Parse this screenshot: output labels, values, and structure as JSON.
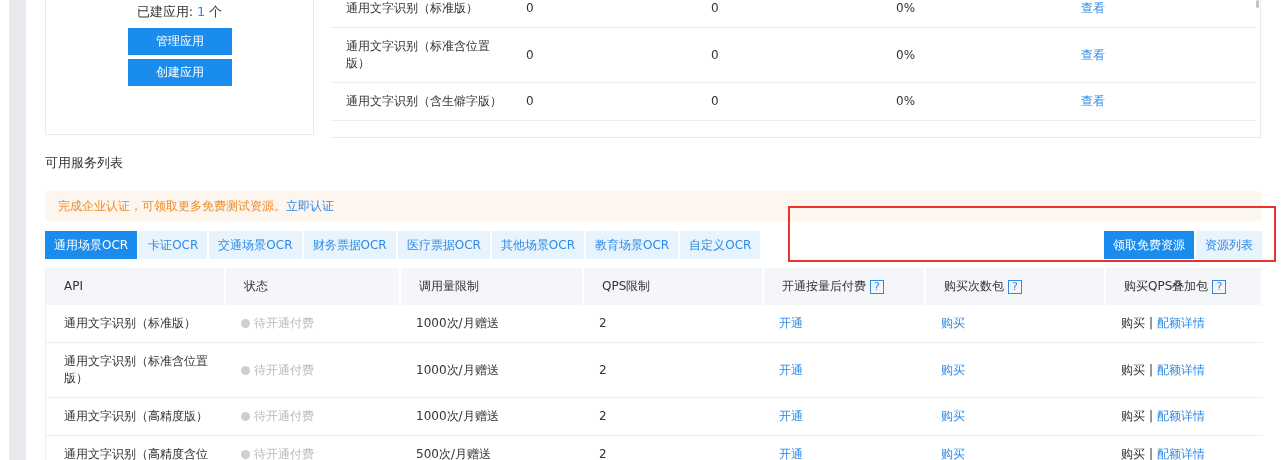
{
  "app_card": {
    "label": "已建应用:",
    "count": "1",
    "unit": "个",
    "buttons": [
      "管理应用",
      "创建应用"
    ]
  },
  "usage_table": {
    "rows": [
      {
        "name": "通用文字识别（标准版）",
        "column_2": "0",
        "column_3": "0",
        "column_4": "0%",
        "action": "查看"
      },
      {
        "name": "通用文字识别（标准含位置版）",
        "column_2": "0",
        "column_3": "0",
        "column_4": "0%",
        "action": "查看"
      },
      {
        "name": "通用文字识别（含生僻字版）",
        "column_2": "0",
        "column_3": "0",
        "column_4": "0%",
        "action": "查看"
      }
    ]
  },
  "services": {
    "title": "可用服务列表",
    "notice": {
      "text": "完成企业认证，可领取更多免费测试资源。",
      "link": "立即认证"
    },
    "tabs": [
      {
        "label": "通用场景OCR",
        "selected": true
      },
      {
        "label": "卡证OCR",
        "selected": false
      },
      {
        "label": "交通场景OCR",
        "selected": false
      },
      {
        "label": "财务票据OCR",
        "selected": false
      },
      {
        "label": "医疗票据OCR",
        "selected": false
      },
      {
        "label": "其他场景OCR",
        "selected": false
      },
      {
        "label": "教育场景OCR",
        "selected": false
      },
      {
        "label": "自定义OCR",
        "selected": false
      }
    ],
    "actions": [
      {
        "label": "领取免费资源",
        "kind": "primary"
      },
      {
        "label": "资源列表",
        "kind": "secondary"
      }
    ],
    "table": {
      "columns": [
        {
          "label": "API"
        },
        {
          "label": "状态"
        },
        {
          "label": "调用量限制"
        },
        {
          "label": "QPS限制"
        },
        {
          "label": "开通按量后付费",
          "help": "?"
        },
        {
          "label": "购买次数包",
          "help": "?"
        },
        {
          "label": "购买QPS叠加包",
          "help": "?"
        }
      ],
      "rows": [
        {
          "api": "通用文字识别（标准版）",
          "status": "待开通付费",
          "quota": "1000次/月赠送",
          "qps": "2",
          "enable": "开通",
          "buy": "购买",
          "pack_buy": "购买",
          "separator": "|",
          "pack_detail": "配额详情"
        },
        {
          "api": "通用文字识别（标准含位置版）",
          "status": "待开通付费",
          "quota": "1000次/月赠送",
          "qps": "2",
          "enable": "开通",
          "buy": "购买",
          "pack_buy": "购买",
          "separator": "|",
          "pack_detail": "配额详情"
        },
        {
          "api": "通用文字识别（高精度版）",
          "status": "待开通付费",
          "quota": "1000次/月赠送",
          "qps": "2",
          "enable": "开通",
          "buy": "购买",
          "pack_buy": "购买",
          "separator": "|",
          "pack_detail": "配额详情"
        },
        {
          "api": "通用文字识别（高精度含位",
          "status": "待开通付费",
          "quota": "500次/月赠送",
          "qps": "2",
          "enable": "开通",
          "buy": "购买",
          "pack_buy": "购买",
          "separator": "|",
          "pack_detail": "配额详情"
        }
      ]
    }
  }
}
